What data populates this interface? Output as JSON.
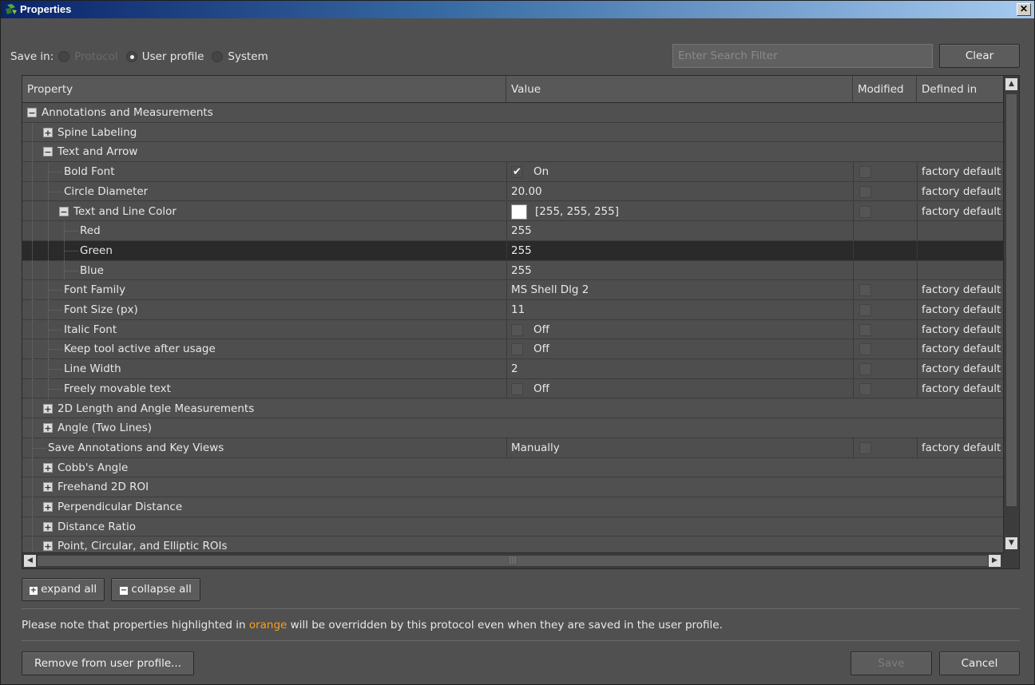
{
  "window": {
    "title": "Properties",
    "close_glyph": "✕"
  },
  "save_in": {
    "label": "Save in:",
    "options": [
      {
        "label": "Protocol",
        "selected": false,
        "disabled": true
      },
      {
        "label": "User profile",
        "selected": true,
        "disabled": false
      },
      {
        "label": "System",
        "selected": false,
        "disabled": false
      }
    ]
  },
  "search": {
    "placeholder": "Enter Search Filter",
    "clear_label": "Clear"
  },
  "columns": {
    "property": "Property",
    "value": "Value",
    "modified": "Modified",
    "defined_in": "Defined in"
  },
  "rows": [
    {
      "label": "Annotations and Measurements",
      "level": 0,
      "expander": "−"
    },
    {
      "label": "Spine Labeling",
      "level": 1,
      "expander": "+"
    },
    {
      "label": "Text and Arrow",
      "level": 1,
      "expander": "−"
    },
    {
      "label": "Bold Font",
      "level": 2,
      "value": "On",
      "checkbox": true,
      "checked": true,
      "modified_box": true,
      "defined_in": "factory default"
    },
    {
      "label": "Circle Diameter",
      "level": 2,
      "value": "20.00",
      "modified_box": true,
      "defined_in": "factory default"
    },
    {
      "label": "Text and Line Color",
      "level": 2,
      "expander": "−",
      "value": "[255, 255, 255]",
      "swatch": "#ffffff",
      "modified_box": true,
      "defined_in": "factory default"
    },
    {
      "label": "Red",
      "level": 3,
      "value": "255"
    },
    {
      "label": "Green",
      "level": 3,
      "value": "255",
      "selected": true
    },
    {
      "label": "Blue",
      "level": 3,
      "value": "255"
    },
    {
      "label": "Font Family",
      "level": 2,
      "value": "MS Shell Dlg 2",
      "modified_box": true,
      "defined_in": "factory default"
    },
    {
      "label": "Font Size (px)",
      "level": 2,
      "value": "11",
      "modified_box": true,
      "defined_in": "factory default"
    },
    {
      "label": "Italic Font",
      "level": 2,
      "value": "Off",
      "checkbox": true,
      "checked": false,
      "modified_box": true,
      "defined_in": "factory default"
    },
    {
      "label": "Keep tool active after usage",
      "level": 2,
      "value": "Off",
      "checkbox": true,
      "checked": false,
      "modified_box": true,
      "defined_in": "factory default"
    },
    {
      "label": "Line Width",
      "level": 2,
      "value": "2",
      "modified_box": true,
      "defined_in": "factory default"
    },
    {
      "label": "Freely movable text",
      "level": 2,
      "value": "Off",
      "checkbox": true,
      "checked": false,
      "modified_box": true,
      "defined_in": "factory default"
    },
    {
      "label": "2D Length and Angle Measurements",
      "level": 1,
      "expander": "+"
    },
    {
      "label": "Angle (Two Lines)",
      "level": 1,
      "expander": "+"
    },
    {
      "label": "Save Annotations and Key Views",
      "level": 1,
      "value": "Manually",
      "modified_box": true,
      "defined_in": "factory default"
    },
    {
      "label": "Cobb's Angle",
      "level": 1,
      "expander": "+"
    },
    {
      "label": "Freehand 2D ROI",
      "level": 1,
      "expander": "+"
    },
    {
      "label": "Perpendicular Distance",
      "level": 1,
      "expander": "+"
    },
    {
      "label": "Distance Ratio",
      "level": 1,
      "expander": "+"
    },
    {
      "label": "Point, Circular, and Elliptic ROIs",
      "level": 1,
      "expander": "+"
    }
  ],
  "tree_buttons": {
    "expand_all": "expand all",
    "collapse_all": "collapse all"
  },
  "note": {
    "before": "Please note that properties highlighted in ",
    "highlight": "orange",
    "after": " will be overridden by this protocol even when they are saved in the user profile.",
    "highlight_color": "#f7a21c"
  },
  "footer": {
    "remove_label": "Remove from user profile...",
    "save_label": "Save",
    "cancel_label": "Cancel"
  }
}
